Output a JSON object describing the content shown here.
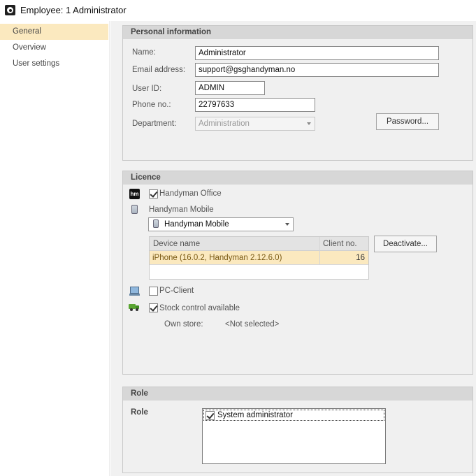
{
  "window": {
    "title": "Employee: 1 Administrator",
    "icon": "gear-icon"
  },
  "sidebar": {
    "items": [
      {
        "label": "General",
        "active": true
      },
      {
        "label": "Overview",
        "active": false
      },
      {
        "label": "User settings",
        "active": false
      }
    ]
  },
  "personal": {
    "header": "Personal information",
    "name_label": "Name:",
    "name_value": "Administrator",
    "email_label": "Email address:",
    "email_value": "support@gsghandyman.no",
    "userid_label": "User ID:",
    "userid_value": "ADMIN",
    "phone_label": "Phone no.:",
    "phone_value": "22797633",
    "department_label": "Department:",
    "department_value": "Administration",
    "password_button": "Password..."
  },
  "licence": {
    "header": "Licence",
    "office_label": "Handyman Office",
    "office_checked": true,
    "mobile_label": "Handyman Mobile",
    "mobile_select_value": "Handyman Mobile",
    "table": {
      "columns": [
        "Device name",
        "Client no."
      ],
      "rows": [
        {
          "device": "iPhone (16.0.2, Handyman 2.12.6.0)",
          "client": "16"
        }
      ]
    },
    "deactivate_button": "Deactivate...",
    "pc_client_label": "PC-Client",
    "pc_client_checked": false,
    "stock_label": "Stock control available",
    "stock_checked": true,
    "own_store_label": "Own store:",
    "own_store_value": "<Not selected>"
  },
  "role": {
    "header": "Role",
    "label": "Role",
    "items": [
      {
        "label": "System administrator",
        "checked": true
      }
    ]
  },
  "colors": {
    "selected_row": "#fbe9bf",
    "panel_header": "#d7d7d7",
    "background": "#f1f1f1"
  }
}
